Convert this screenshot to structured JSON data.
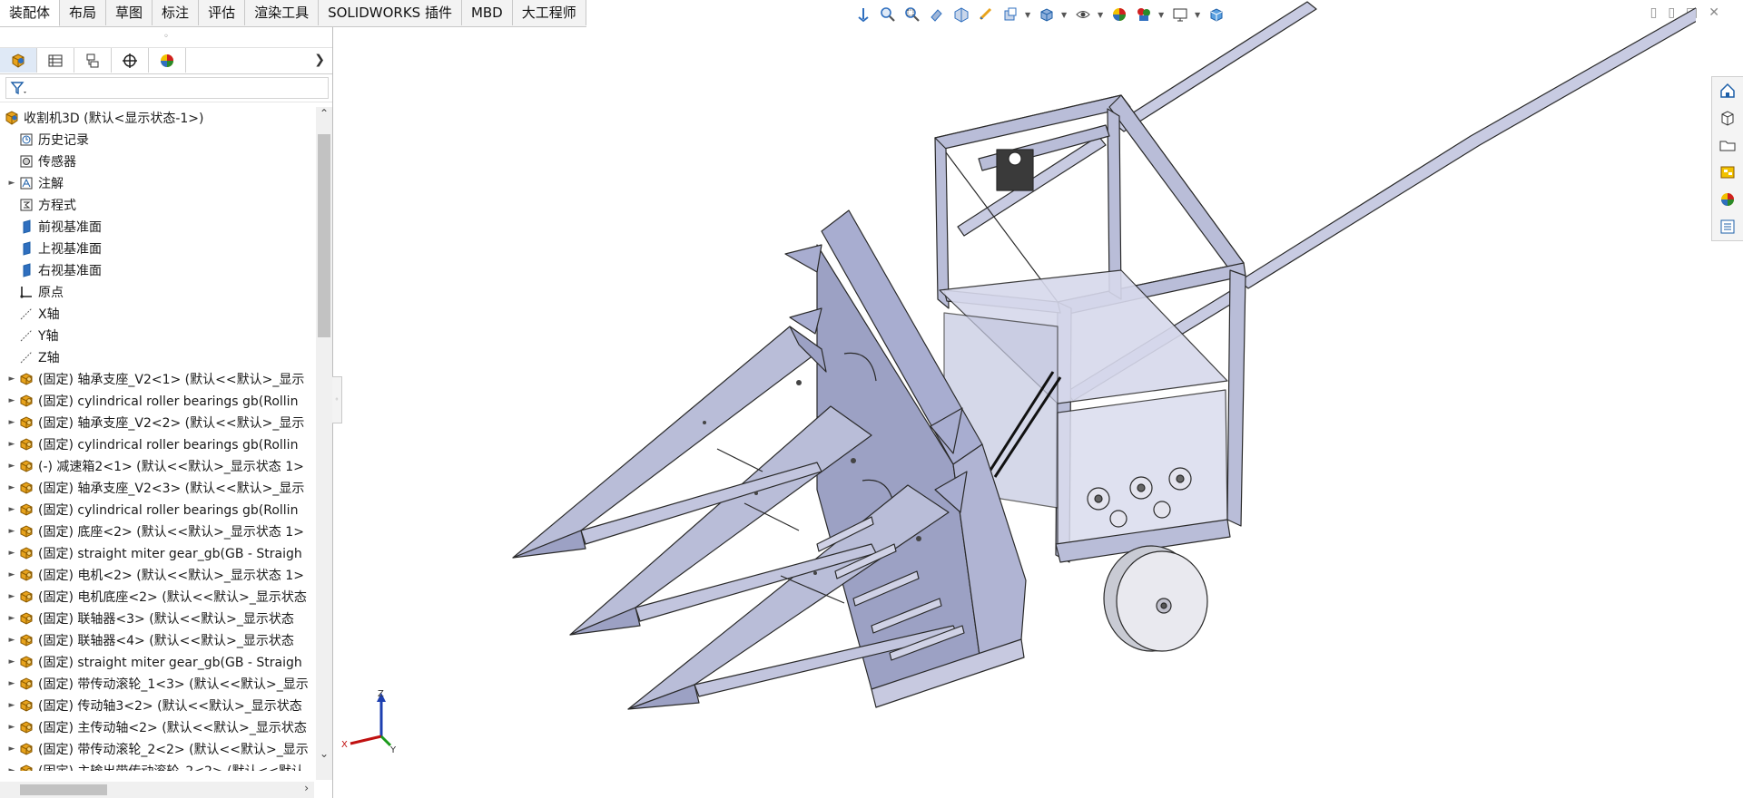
{
  "ribbon": {
    "tabs": [
      {
        "label": "装配体",
        "active": true
      },
      {
        "label": "布局"
      },
      {
        "label": "草图"
      },
      {
        "label": "标注"
      },
      {
        "label": "评估"
      },
      {
        "label": "渲染工具"
      },
      {
        "label": "SOLIDWORKS 插件"
      },
      {
        "label": "MBD"
      },
      {
        "label": "大工程师"
      }
    ]
  },
  "panel": {
    "tabs": [
      "feature-manager",
      "property-manager",
      "configuration-manager",
      "dimxpert-manager",
      "display-manager"
    ],
    "filter_icon": "filter-icon"
  },
  "tree": {
    "root": "收割机3D (默认<显示状态-1>)",
    "items": [
      {
        "label": "历史记录",
        "icon": "history-icon",
        "expandable": false
      },
      {
        "label": "传感器",
        "icon": "sensor-icon",
        "expandable": false
      },
      {
        "label": "注解",
        "icon": "annotation-icon",
        "expandable": true
      },
      {
        "label": "方程式",
        "icon": "equation-icon",
        "expandable": false
      },
      {
        "label": "前视基准面",
        "icon": "plane-icon",
        "expandable": false
      },
      {
        "label": "上视基准面",
        "icon": "plane-icon",
        "expandable": false
      },
      {
        "label": "右视基准面",
        "icon": "plane-icon",
        "expandable": false
      },
      {
        "label": "原点",
        "icon": "origin-icon",
        "expandable": false
      },
      {
        "label": "X轴",
        "icon": "axis-icon",
        "expandable": false
      },
      {
        "label": "Y轴",
        "icon": "axis-icon",
        "expandable": false
      },
      {
        "label": "Z轴",
        "icon": "axis-icon",
        "expandable": false
      },
      {
        "label": "(固定) 轴承支座_V2<1> (默认<<默认>_显示",
        "icon": "part-icon",
        "expandable": true
      },
      {
        "label": "(固定) cylindrical roller bearings gb(Rollin",
        "icon": "part-icon",
        "expandable": true
      },
      {
        "label": "(固定) 轴承支座_V2<2> (默认<<默认>_显示",
        "icon": "part-icon",
        "expandable": true
      },
      {
        "label": "(固定) cylindrical roller bearings gb(Rollin",
        "icon": "part-icon",
        "expandable": true
      },
      {
        "label": "(-) 减速箱2<1> (默认<<默认>_显示状态 1>",
        "icon": "part-icon",
        "expandable": true
      },
      {
        "label": "(固定) 轴承支座_V2<3> (默认<<默认>_显示",
        "icon": "part-icon",
        "expandable": true
      },
      {
        "label": "(固定) cylindrical roller bearings gb(Rollin",
        "icon": "part-icon",
        "expandable": true
      },
      {
        "label": "(固定) 底座<2> (默认<<默认>_显示状态 1>",
        "icon": "part-icon",
        "expandable": true
      },
      {
        "label": "(固定) straight miter gear_gb(GB - Straigh",
        "icon": "part-icon",
        "expandable": true
      },
      {
        "label": "(固定) 电机<2> (默认<<默认>_显示状态 1>",
        "icon": "part-icon",
        "expandable": true
      },
      {
        "label": "(固定) 电机底座<2> (默认<<默认>_显示状态",
        "icon": "part-icon",
        "expandable": true
      },
      {
        "label": "(固定) 联轴器<3> (默认<<默认>_显示状态",
        "icon": "part-icon",
        "expandable": true
      },
      {
        "label": "(固定) 联轴器<4> (默认<<默认>_显示状态",
        "icon": "part-icon",
        "expandable": true
      },
      {
        "label": "(固定) straight miter gear_gb(GB - Straigh",
        "icon": "part-icon",
        "expandable": true
      },
      {
        "label": "(固定) 带传动滚轮_1<3> (默认<<默认>_显示",
        "icon": "part-icon",
        "expandable": true
      },
      {
        "label": "(固定) 传动轴3<2> (默认<<默认>_显示状态",
        "icon": "part-icon",
        "expandable": true
      },
      {
        "label": "(固定) 主传动轴<2> (默认<<默认>_显示状态",
        "icon": "part-icon",
        "expandable": true
      },
      {
        "label": "(固定) 带传动滚轮_2<2> (默认<<默认>_显示",
        "icon": "part-icon",
        "expandable": true
      },
      {
        "label": "(固定) 主输出带传动滚轮_2<2> (默认<<默认",
        "icon": "part-icon",
        "expandable": true
      }
    ]
  },
  "hud": {
    "icons": [
      "view-orientation-icon",
      "zoom-to-fit-icon",
      "zoom-area-icon",
      "previous-view-icon",
      "section-view-icon",
      "dynamic-annotation-icon",
      "view-settings-icon",
      "display-style-icon",
      "hide-show-icon",
      "edit-appearance-icon",
      "apply-scene-icon",
      "view-settings-monitor-icon",
      "3d-view-icon"
    ]
  },
  "task_pane": {
    "icons": [
      "home-icon",
      "design-library-icon",
      "file-explorer-icon",
      "view-palette-icon",
      "appearances-icon",
      "custom-properties-icon"
    ]
  },
  "triad": {
    "x": "X",
    "y": "Y",
    "z": "Z"
  },
  "colors": {
    "model_fill": "#b9bdd8",
    "model_dark": "#9ca1c4",
    "model_edge": "#2a2a2a",
    "part_icon": "#e8a31c",
    "accent": "#2f6fbf"
  }
}
